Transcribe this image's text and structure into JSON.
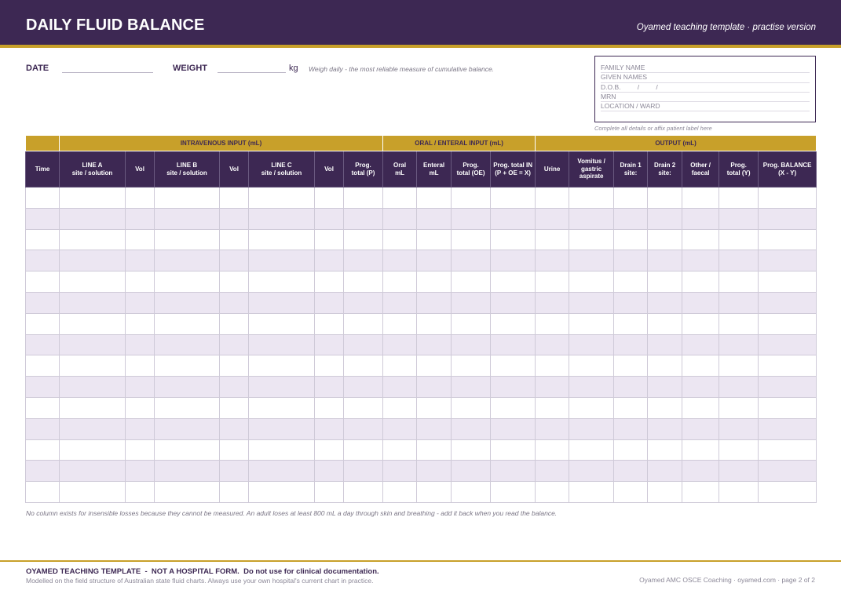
{
  "header": {
    "title": "DAILY FLUID BALANCE",
    "template_tag": "Oyamed teaching template  ·  practise version"
  },
  "fields": {
    "date_label": "DATE",
    "weight_label": "WEIGHT",
    "weight_unit": "kg",
    "weight_hint": "Weigh daily - the most reliable measure of cumulative balance."
  },
  "patient": {
    "family_name": "FAMILY NAME",
    "given_names": "GIVEN NAMES",
    "dob": "D.O.B.         /         /",
    "mrn": "MRN",
    "location": "LOCATION / WARD",
    "note": "Complete all details or affix patient label here"
  },
  "table": {
    "groups": {
      "iv": "INTRAVENOUS INPUT (mL)",
      "oral": "ORAL / ENTERAL INPUT (mL)",
      "output": "OUTPUT (mL)"
    },
    "columns": [
      [
        "Time"
      ],
      [
        "LINE A",
        "site / solution"
      ],
      [
        "Vol"
      ],
      [
        "LINE B",
        "site / solution"
      ],
      [
        "Vol"
      ],
      [
        "LINE C",
        "site / solution"
      ],
      [
        "Vol"
      ],
      [
        "Prog.",
        "total (P)"
      ],
      [
        "Oral",
        "mL"
      ],
      [
        "Enteral",
        "mL"
      ],
      [
        "Prog.",
        "total (OE)"
      ],
      [
        "Prog. total IN",
        "(P + OE = X)"
      ],
      [
        "Urine"
      ],
      [
        "Vomitus /",
        "gastric aspirate"
      ],
      [
        "Drain 1",
        "site:"
      ],
      [
        "Drain 2",
        "site:"
      ],
      [
        "Other /",
        "faecal"
      ],
      [
        "Prog.",
        "total (Y)"
      ],
      [
        "Prog. BALANCE",
        "(X - Y)"
      ]
    ]
  },
  "footer": {
    "insensible_note": "No column exists for insensible losses because they cannot be measured. An adult loses at least 800 mL a day through skin and breathing - add it back when you read the balance.",
    "main": "OYAMED TEACHING TEMPLATE  -  NOT A HOSPITAL FORM.  Do not use for clinical documentation.",
    "sub": "Modelled on the field structure of Australian state fluid charts. Always use your own hospital's current chart in practice.",
    "right": "Oyamed AMC OSCE Coaching  ·  oyamed.com  ·  page 2 of 2"
  }
}
